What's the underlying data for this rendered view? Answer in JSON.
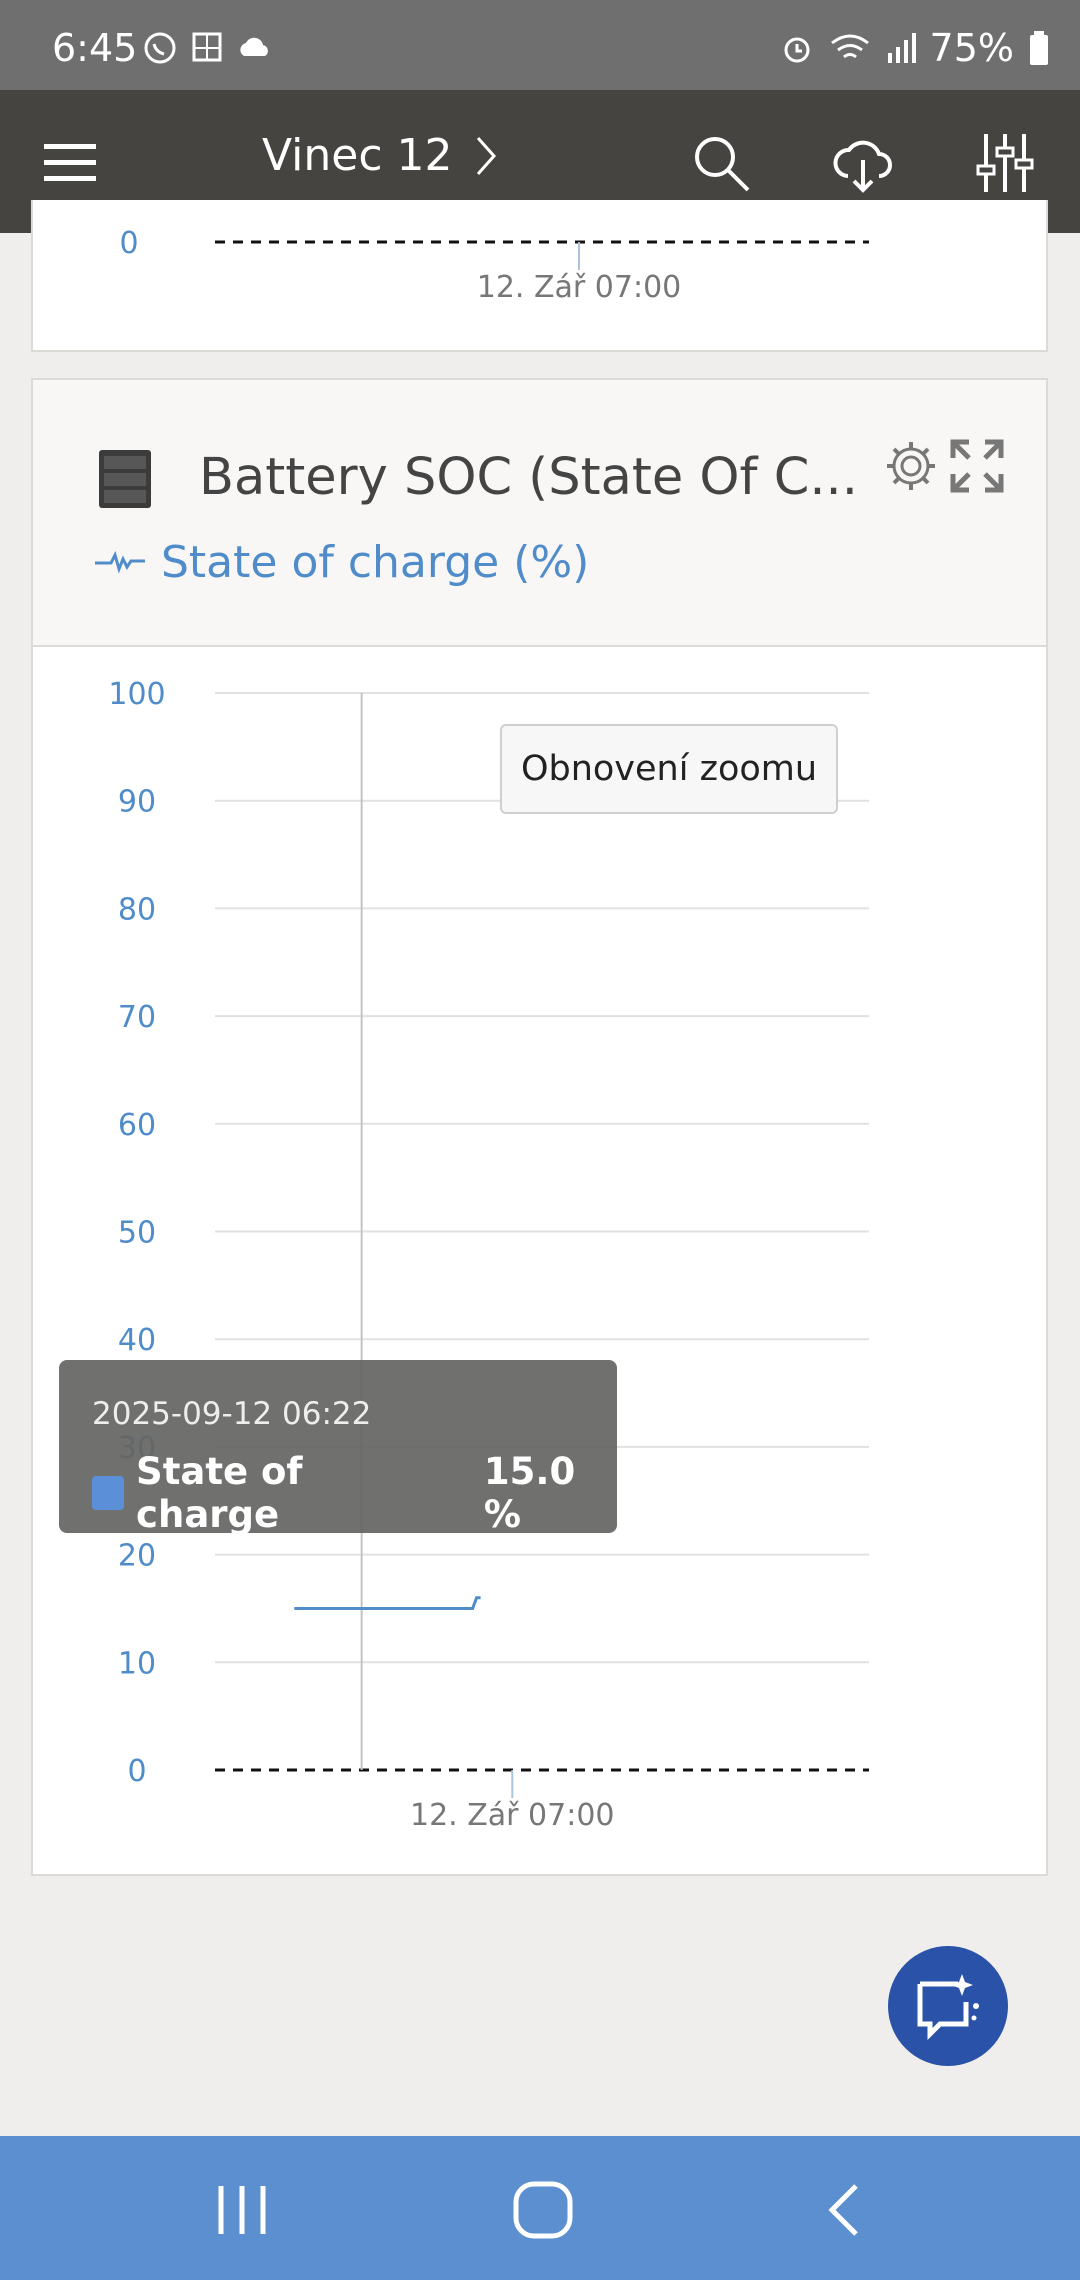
{
  "status_bar": {
    "time": "6:45",
    "battery": "75%",
    "left_icons": [
      "whatsapp-icon",
      "photo-icon",
      "cloud-icon"
    ],
    "right_icons": [
      "alarm-icon",
      "wifi-icon",
      "signal-icon",
      "battery-icon"
    ]
  },
  "app_bar": {
    "title": "Vinec 12",
    "icons": [
      "menu-icon",
      "chevron-right-icon",
      "search-icon",
      "cloud-download-icon",
      "sliders-icon"
    ]
  },
  "prev_card": {
    "y_label": "0",
    "x_label": "12. Zář 07:00"
  },
  "soc_card": {
    "title": "Battery SOC (State Of C...",
    "series_label": "State of charge (%)",
    "reset_zoom_label": "Obnovení zoomu",
    "tooltip": {
      "date": "2025-09-12 06:22",
      "series": "State of charge",
      "value": "15.0 %"
    }
  },
  "chart_data": {
    "type": "line",
    "title": "Battery SOC (State Of C...",
    "ylim": [
      0,
      100
    ],
    "y_ticks": [
      0,
      10,
      20,
      30,
      40,
      50,
      60,
      70,
      80,
      90,
      100
    ],
    "x_tick_label": "12. Zář 07:00",
    "grid": true,
    "series": [
      {
        "name": "State of charge",
        "color": "#4f8cc9",
        "x": [
          "2025-09-12 06:05",
          "2025-09-12 06:50",
          "2025-09-12 06:51",
          "2025-09-12 06:52"
        ],
        "values": [
          15.0,
          15.0,
          16.0,
          16.0
        ]
      }
    ],
    "crosshair_x": "2025-09-12 06:22"
  },
  "colors": {
    "accent": "#4f8cc9",
    "app_bar": "#464440",
    "nav_bar": "#5b8fd0",
    "fab": "#2a52a8"
  }
}
